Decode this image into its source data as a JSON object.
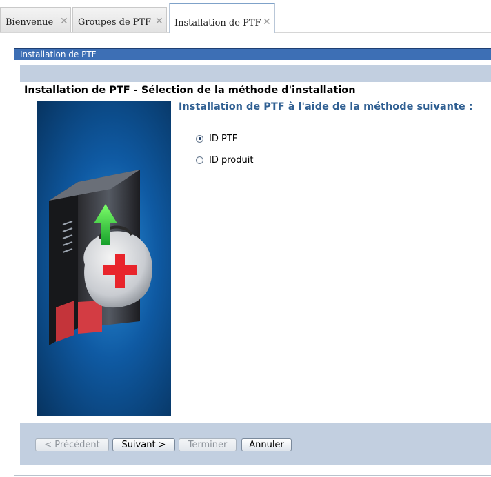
{
  "tabs": [
    {
      "label": "Bienvenue",
      "close": "✕"
    },
    {
      "label": "Groupes de PTF",
      "close": "✕"
    },
    {
      "label": "Installation de PTF",
      "close": "✕",
      "active": true
    }
  ],
  "portlet": {
    "title": "Installation de PTF",
    "heading": "Installation de PTF - Sélection de la méthode d'installation",
    "subtitle": "Installation de PTF à l'aide de la méthode suivante :",
    "image_icon": "server-upgrade-kit-illustration"
  },
  "options": [
    {
      "label": "ID PTF",
      "selected": true
    },
    {
      "label": "ID produit",
      "selected": false
    }
  ],
  "buttons": {
    "previous": "< Précédent",
    "next": "Suivant >",
    "finish": "Terminer",
    "cancel": "Annuler"
  },
  "colors": {
    "title_bar": "#3d6fb5",
    "band": "#c2cfe0",
    "subtitle": "#2f5f92"
  }
}
